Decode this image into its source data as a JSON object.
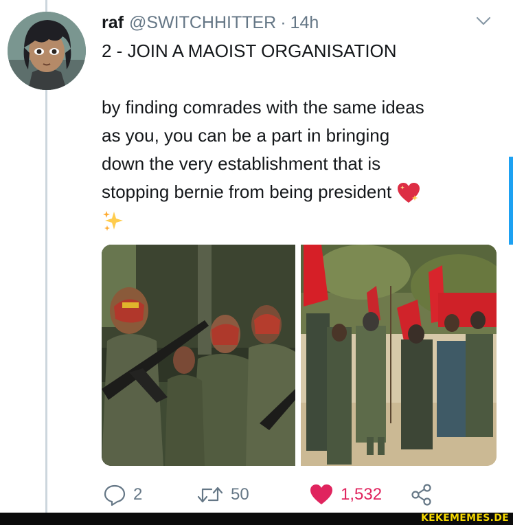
{
  "tweet": {
    "display_name": "raf",
    "handle": "@SWITCHHITTER",
    "separator": "·",
    "time": "14h",
    "lines": [
      "2 - JOIN A MAOIST ORGANISATION",
      "",
      "by finding comrades with the same ideas",
      "as you, you can be a part in bringing",
      "down the very establishment that is",
      "stopping bernie from being president"
    ],
    "emojis": [
      "sparkling-heart",
      "sparkles"
    ],
    "media": [
      {
        "name": "photo-armed-fighters-face-paint"
      },
      {
        "name": "photo-uniformed-march-red-flags"
      }
    ]
  },
  "actions": {
    "replies": "2",
    "retweets": "50",
    "likes": "1,532"
  },
  "icons": [
    "reply-icon",
    "retweet-icon",
    "heart-icon",
    "share-icon",
    "chevron-down-icon"
  ],
  "colors": {
    "text": "#14171a",
    "muted": "#657786",
    "like": "#e0245e",
    "accent": "#1da1f2",
    "watermark": "#f5d800"
  },
  "watermark": "KEKEMEMES.DE"
}
